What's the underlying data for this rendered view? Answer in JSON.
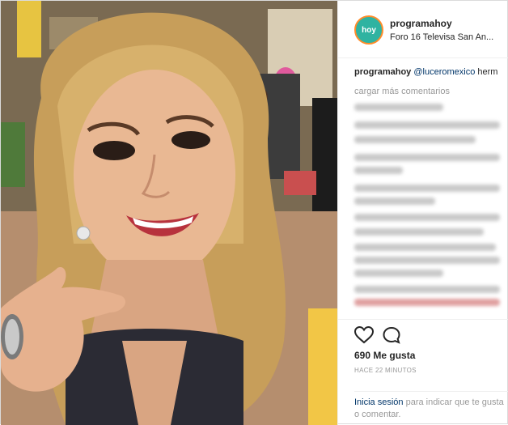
{
  "post": {
    "username": "programahoy",
    "location": "Foro 16 Televisa San An...",
    "logo_text": "hoy",
    "caption_user": "programahoy",
    "caption_mention": "@luceromexico",
    "caption_text": "herm",
    "load_more": "cargar más comentarios",
    "likes": "690 Me gusta",
    "time": "HACE 22 MINUTOS",
    "login_link": "Inicia sesión",
    "login_text": "para indicar que te gusta o comentar."
  },
  "icons": [
    "heart-icon",
    "comment-icon"
  ],
  "colors": {
    "brand": "#2fb3a1",
    "accent": "#ff8c2a",
    "link": "#003569"
  }
}
